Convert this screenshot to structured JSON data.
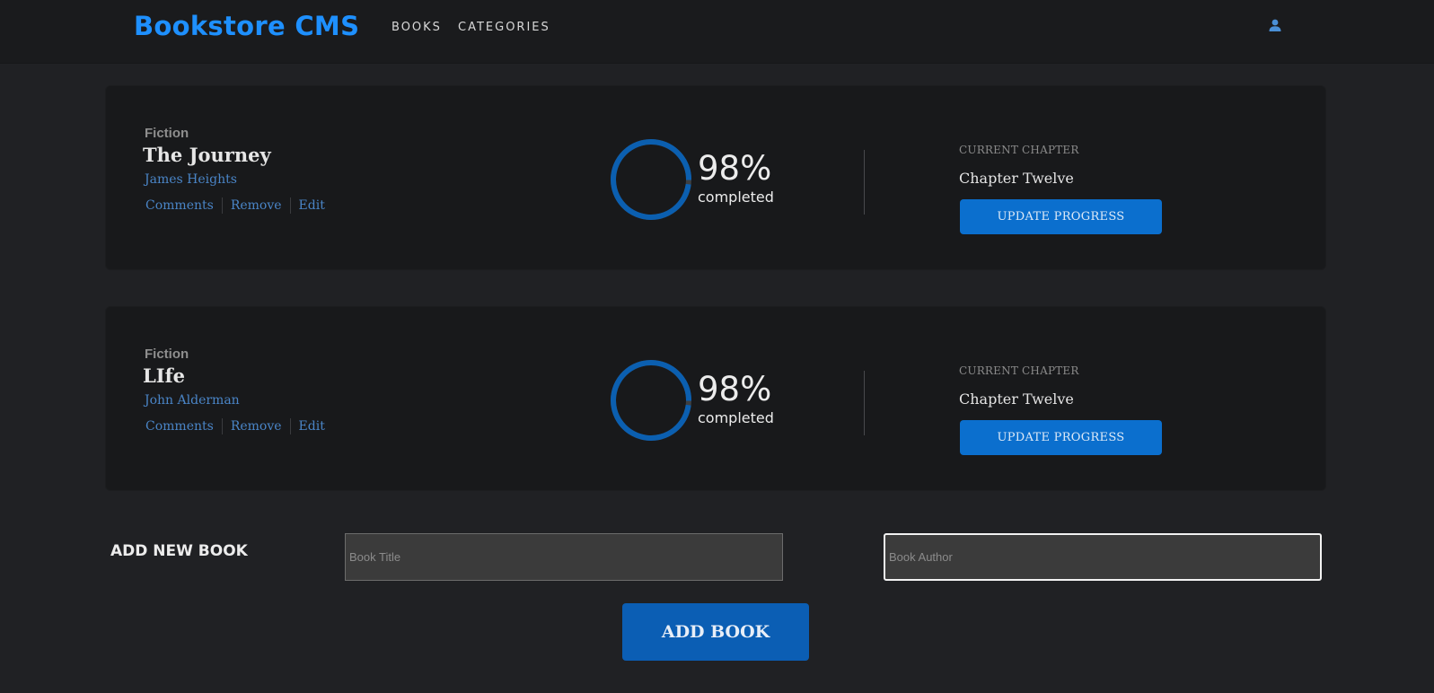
{
  "header": {
    "brand": "Bookstore CMS",
    "nav": [
      {
        "label": "BOOKS"
      },
      {
        "label": "CATEGORIES"
      }
    ],
    "user_icon": "user-icon"
  },
  "books": [
    {
      "category": "Fiction",
      "title": "The Journey",
      "author": "James Heights",
      "actions": {
        "comments": "Comments",
        "remove": "Remove",
        "edit": "Edit"
      },
      "progress": 98,
      "percent_text": "98%",
      "completed_text": "completed",
      "current_chapter_label": "CURRENT CHAPTER",
      "current_chapter": "Chapter Twelve",
      "update_label": "UPDATE PROGRESS"
    },
    {
      "category": "Fiction",
      "title": "LIfe",
      "author": "John Alderman",
      "actions": {
        "comments": "Comments",
        "remove": "Remove",
        "edit": "Edit"
      },
      "progress": 98,
      "percent_text": "98%",
      "completed_text": "completed",
      "current_chapter_label": "CURRENT CHAPTER",
      "current_chapter": "Chapter Twelve",
      "update_label": "UPDATE PROGRESS"
    }
  ],
  "add_form": {
    "heading": "ADD NEW BOOK",
    "title_placeholder": "Book Title",
    "author_placeholder": "Book Author",
    "title_value": "",
    "author_value": "",
    "submit_label": "ADD BOOK"
  },
  "colors": {
    "brand": "#1e90ff",
    "progress": "#0b5fb0",
    "progress_track": "#3d3f42",
    "button": "#0b6fce"
  }
}
